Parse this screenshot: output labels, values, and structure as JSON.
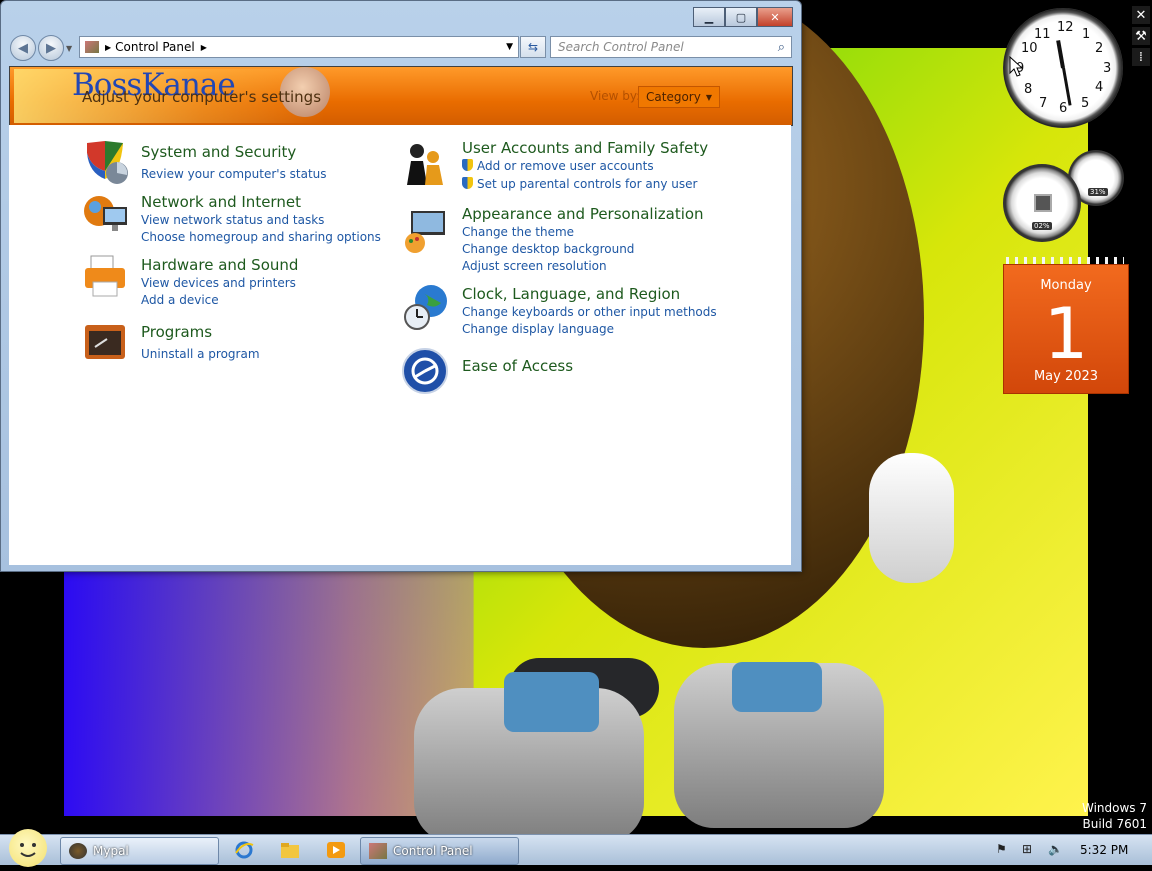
{
  "window": {
    "address": {
      "root_icon": "control-panel-icon",
      "crumb": "Control Panel"
    },
    "search_placeholder": "Search Control Panel",
    "banner": {
      "logo_text": "BossKanae",
      "subtitle": "Adjust your computer's settings",
      "view_by_label": "View by:",
      "view_by_value": "Category"
    },
    "categories_left": [
      {
        "title": "System and Security",
        "icon": "shield-icon",
        "links": [
          "Review your computer's status"
        ]
      },
      {
        "title": "Network and Internet",
        "icon": "network-icon",
        "links": [
          "View network status and tasks",
          "Choose homegroup and sharing options"
        ]
      },
      {
        "title": "Hardware and Sound",
        "icon": "printer-icon",
        "links": [
          "View devices and printers",
          "Add a device"
        ]
      },
      {
        "title": "Programs",
        "icon": "programs-icon",
        "links": [
          "Uninstall a program"
        ]
      }
    ],
    "categories_right": [
      {
        "title": "User Accounts and Family Safety",
        "icon": "users-icon",
        "links": [
          "Add or remove user accounts",
          "Set up parental controls for any user"
        ]
      },
      {
        "title": "Appearance and Personalization",
        "icon": "monitor-paint-icon",
        "links": [
          "Change the theme",
          "Change desktop background",
          "Adjust screen resolution"
        ]
      },
      {
        "title": "Clock, Language, and Region",
        "icon": "globe-clock-icon",
        "links": [
          "Change keyboards or other input methods",
          "Change display language"
        ]
      },
      {
        "title": "Ease of Access",
        "icon": "ease-of-access-icon",
        "links": []
      }
    ]
  },
  "gadgets": {
    "clock_numbers": [
      "12",
      "1",
      "2",
      "3",
      "4",
      "5",
      "6",
      "7",
      "8",
      "9",
      "10",
      "11"
    ],
    "cpu_meter": {
      "cpu": "02%",
      "ram": "31%"
    },
    "calendar": {
      "day_name": "Monday",
      "day": "1",
      "month_year": "May 2023"
    }
  },
  "watermark": {
    "line1": "Windows 7",
    "line2": "Build 7601"
  },
  "taskbar": {
    "buttons": [
      {
        "label": "Mypal"
      },
      {
        "label": "Control Panel"
      }
    ],
    "time": "5:32 PM"
  }
}
